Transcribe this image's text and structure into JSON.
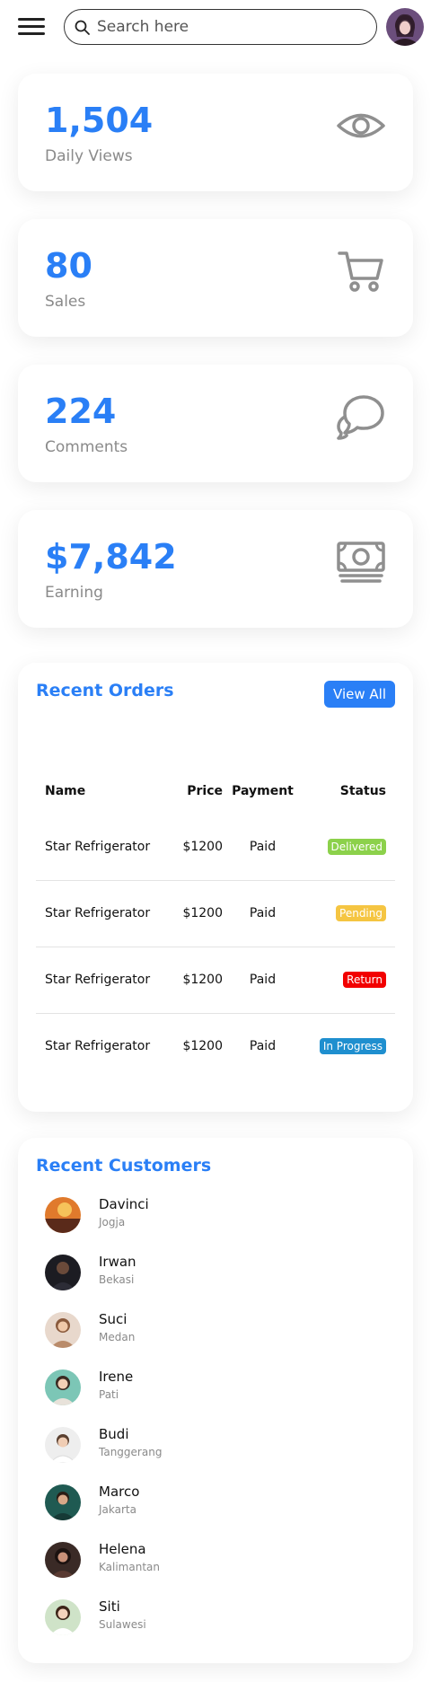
{
  "header": {
    "search_placeholder": "Search here"
  },
  "stats": [
    {
      "value": "1,504",
      "label": "Daily Views",
      "icon": "eye-icon"
    },
    {
      "value": "80",
      "label": "Sales",
      "icon": "cart-icon"
    },
    {
      "value": "224",
      "label": "Comments",
      "icon": "chat-icon"
    },
    {
      "value": "$7,842",
      "label": "Earning",
      "icon": "money-icon"
    }
  ],
  "orders": {
    "title": "Recent Orders",
    "view_all": "View All",
    "columns": [
      "Name",
      "Price",
      "Payment",
      "Status"
    ],
    "rows": [
      {
        "name": "Star Refrigerator",
        "price": "$1200",
        "payment": "Paid",
        "status": "Delivered",
        "status_color": "#8cd14b"
      },
      {
        "name": "Star Refrigerator",
        "price": "$1200",
        "payment": "Paid",
        "status": "Pending",
        "status_color": "#f5c542"
      },
      {
        "name": "Star Refrigerator",
        "price": "$1200",
        "payment": "Paid",
        "status": "Return",
        "status_color": "#f20000"
      },
      {
        "name": "Star Refrigerator",
        "price": "$1200",
        "payment": "Paid",
        "status": "In Progress",
        "status_color": "#1f8fcf"
      }
    ]
  },
  "customers": {
    "title": "Recent Customers",
    "items": [
      {
        "name": "Davinci",
        "city": "Jogja"
      },
      {
        "name": "Irwan",
        "city": "Bekasi"
      },
      {
        "name": "Suci",
        "city": "Medan"
      },
      {
        "name": "Irene",
        "city": "Pati"
      },
      {
        "name": "Budi",
        "city": "Tanggerang"
      },
      {
        "name": "Marco",
        "city": "Jakarta"
      },
      {
        "name": "Helena",
        "city": "Kalimantan"
      },
      {
        "name": "Siti",
        "city": "Sulawesi"
      }
    ]
  },
  "colors": {
    "accent": "#2a7ff6",
    "label_gray": "#8a8a8a"
  }
}
